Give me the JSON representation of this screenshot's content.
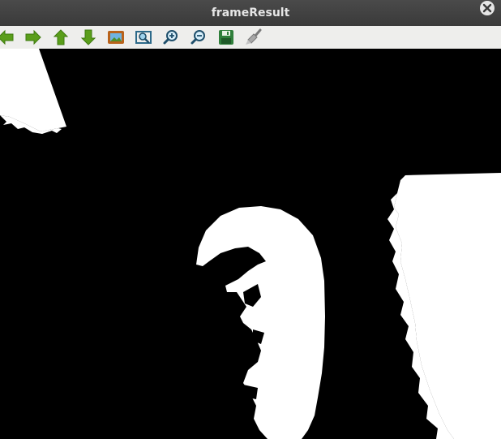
{
  "window": {
    "title": "frameResult"
  },
  "toolbar": {
    "buttons": [
      {
        "icon": "arrow-left-icon"
      },
      {
        "icon": "arrow-right-icon"
      },
      {
        "icon": "arrow-up-icon"
      },
      {
        "icon": "arrow-down-icon"
      },
      {
        "icon": "image-icon"
      },
      {
        "icon": "zoom-fit-icon"
      },
      {
        "icon": "zoom-in-icon"
      },
      {
        "icon": "zoom-out-icon"
      },
      {
        "icon": "save-icon"
      },
      {
        "icon": "brush-icon"
      }
    ]
  },
  "colors": {
    "titlebar": "#3e3e3e",
    "toolbar": "#eeeeec",
    "arrow_green": "#5a9e1a",
    "canvas_bg": "#000000",
    "foreground_mask": "#ffffff"
  }
}
